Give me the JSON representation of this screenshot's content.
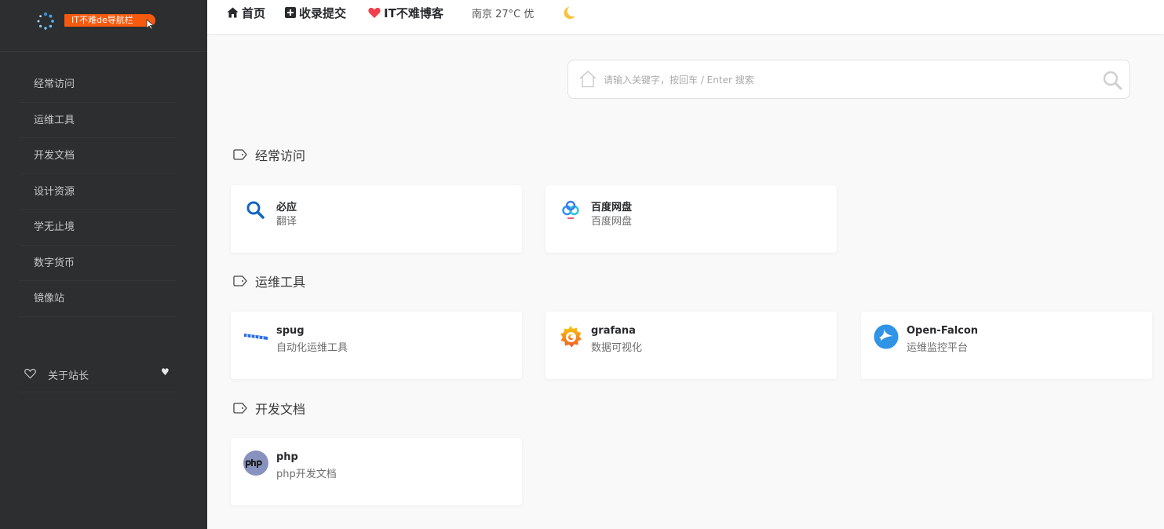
{
  "logo": {
    "badge_text": "IT不难de导航栏"
  },
  "sidebar": {
    "items": [
      {
        "label": "经常访问"
      },
      {
        "label": "运维工具"
      },
      {
        "label": "开发文档"
      },
      {
        "label": "设计资源"
      },
      {
        "label": "学无止境"
      },
      {
        "label": "数字货币"
      },
      {
        "label": "镜像站"
      }
    ],
    "about_label": "关于站长",
    "about_heart": "♥"
  },
  "topbar": {
    "home_label": "首页",
    "submit_label": "收录提交",
    "blog_label": "IT不难博客",
    "weather": "南京  27°C  优"
  },
  "search": {
    "placeholder": "请输入关键字，按回车 / Enter 搜索"
  },
  "sections": [
    {
      "title": "经常访问",
      "cards": [
        {
          "name": "必应",
          "desc": "翻译",
          "icon": "bing-search-icon"
        },
        {
          "name": "百度网盘",
          "desc": "百度网盘",
          "icon": "baidu-netdisk-icon"
        }
      ]
    },
    {
      "title": "运维工具",
      "cards": [
        {
          "name": "spug",
          "desc": "自动化运维工具",
          "icon": "spug-icon"
        },
        {
          "name": "grafana",
          "desc": "数据可视化",
          "icon": "grafana-icon"
        },
        {
          "name": "Open-Falcon",
          "desc": "运维监控平台",
          "icon": "open-falcon-icon"
        }
      ]
    },
    {
      "title": "开发文档",
      "cards": [
        {
          "name": "php",
          "desc": "php开发文档",
          "icon": "php-icon"
        }
      ]
    }
  ],
  "colors": {
    "sidebar_bg": "#2c2e2f",
    "accent": "#f65a0f",
    "heart": "#f1404b"
  }
}
